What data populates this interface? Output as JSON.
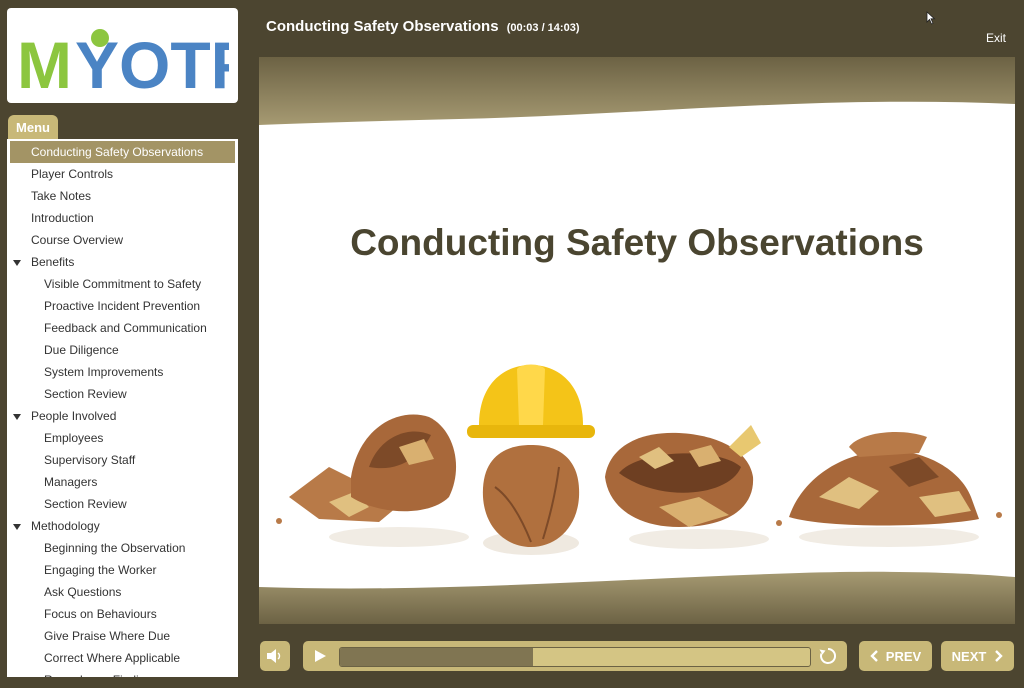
{
  "header": {
    "title": "Conducting Safety Observations",
    "time": "(00:03 / 14:03)",
    "exit_label": "Exit"
  },
  "logo": {
    "text": "MYOTF",
    "colors": {
      "m": "#8cc63f",
      "rest": "#4b84c4"
    }
  },
  "menu": {
    "tab_label": "Menu",
    "items": [
      {
        "label": "Conducting Safety Observations",
        "level": 0,
        "active": true
      },
      {
        "label": "Player Controls",
        "level": 0
      },
      {
        "label": "Take Notes",
        "level": 0
      },
      {
        "label": "Introduction",
        "level": 0
      },
      {
        "label": "Course Overview",
        "level": 0
      },
      {
        "label": "Benefits",
        "level": 0,
        "expanded": true
      },
      {
        "label": "Visible Commitment to Safety",
        "level": 1
      },
      {
        "label": "Proactive Incident Prevention",
        "level": 1
      },
      {
        "label": "Feedback and Communication",
        "level": 1
      },
      {
        "label": "Due Diligence",
        "level": 1
      },
      {
        "label": "System Improvements",
        "level": 1
      },
      {
        "label": "Section Review",
        "level": 1
      },
      {
        "label": "People Involved",
        "level": 0,
        "expanded": true
      },
      {
        "label": "Employees",
        "level": 1
      },
      {
        "label": "Supervisory Staff",
        "level": 1
      },
      {
        "label": "Managers",
        "level": 1
      },
      {
        "label": "Section Review",
        "level": 1
      },
      {
        "label": "Methodology",
        "level": 0,
        "expanded": true
      },
      {
        "label": "Beginning the Observation",
        "level": 1
      },
      {
        "label": "Engaging the Worker",
        "level": 1
      },
      {
        "label": "Ask Questions",
        "level": 1
      },
      {
        "label": "Focus on Behaviours",
        "level": 1
      },
      {
        "label": "Give Praise Where Due",
        "level": 1
      },
      {
        "label": "Correct Where Applicable",
        "level": 1
      },
      {
        "label": "Record your Findings",
        "level": 1
      }
    ]
  },
  "slide": {
    "title": "Conducting Safety Observations"
  },
  "controls": {
    "volume_icon": "speaker-icon",
    "play_icon": "play-icon",
    "replay_icon": "replay-icon",
    "progress_fraction": 0.41,
    "prev_label": "PREV",
    "next_label": "NEXT"
  },
  "theme": {
    "background": "#4c4530",
    "accent": "#c8b878",
    "active_menu": "#a39465",
    "slide_band": "#8a7d55",
    "title_text": "#4a4530"
  }
}
